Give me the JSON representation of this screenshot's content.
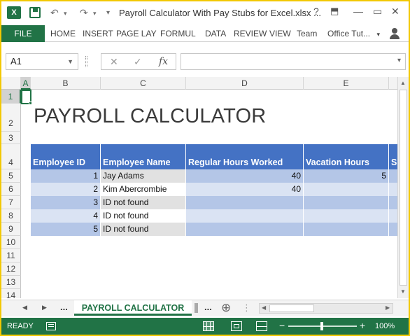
{
  "window": {
    "title": "Payroll Calculator With Pay Stubs for Excel.xlsx ...",
    "help": "?",
    "minimize": "—",
    "restore": "▭",
    "close": "✕"
  },
  "qat": {
    "app_icon": "excel-logo",
    "undo": "↶",
    "redo": "↷",
    "more": "▾"
  },
  "ribbon": {
    "file": "FILE",
    "tabs": [
      "HOME",
      "INSERT",
      "PAGE LAY",
      "FORMUL",
      "DATA",
      "REVIEW",
      "VIEW",
      "Team"
    ],
    "account": "Office Tut...",
    "account_dd": "▾"
  },
  "formula_bar": {
    "name_box": "A1",
    "cancel": "✕",
    "enter": "✓",
    "fx": "fx",
    "value": ""
  },
  "columns": [
    "A",
    "B",
    "C",
    "D",
    "E"
  ],
  "rows": [
    "1",
    "2",
    "3",
    "4",
    "5",
    "6",
    "7",
    "8",
    "9",
    "10",
    "11",
    "12",
    "13",
    "14"
  ],
  "sheet": {
    "title": "PAYROLL CALCULATOR",
    "headers": [
      "Employee ID",
      "Employee Name",
      "Regular Hours Worked",
      "Vacation Hours",
      "S"
    ],
    "data": [
      {
        "id": "1",
        "name": "Jay Adams",
        "regular": "40",
        "vacation": "5"
      },
      {
        "id": "2",
        "name": "Kim Abercrombie",
        "regular": "40",
        "vacation": ""
      },
      {
        "id": "3",
        "name": "ID not found",
        "regular": "",
        "vacation": ""
      },
      {
        "id": "4",
        "name": "ID not found",
        "regular": "",
        "vacation": ""
      },
      {
        "id": "5",
        "name": "ID not found",
        "regular": "",
        "vacation": ""
      }
    ]
  },
  "sheet_tabs": {
    "prev": "◀",
    "next": "▶",
    "more_left": "...",
    "active": "PAYROLL CALCULATOR",
    "more_right": "...",
    "add": "⊕"
  },
  "status": {
    "ready": "READY",
    "zoom": "100%",
    "minus": "−",
    "plus": "+"
  },
  "colors": {
    "brand": "#217346",
    "header": "#4472c4",
    "band_dark": "#b4c6e7",
    "band_light": "#dae3f3",
    "name_band": "#e1e1e1"
  }
}
